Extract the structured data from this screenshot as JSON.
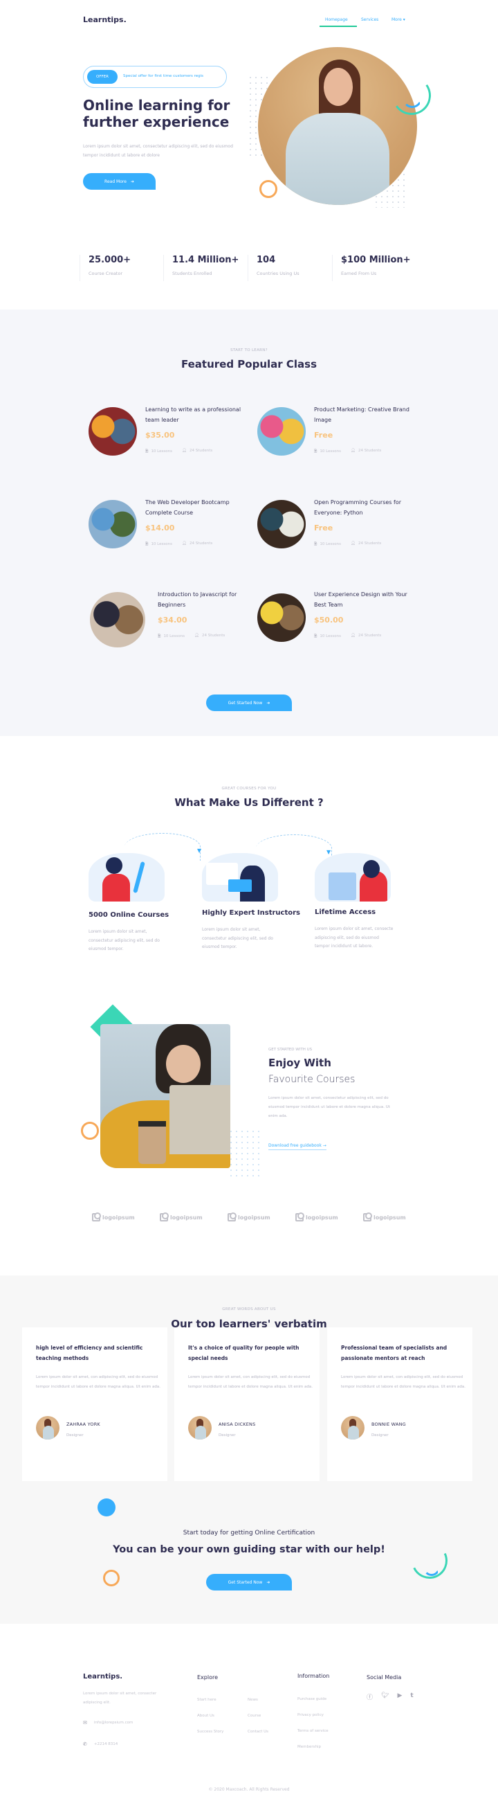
{
  "header": {
    "logo": "Learntips.",
    "nav": [
      {
        "label": "Homepage",
        "active": true
      },
      {
        "label": "Services",
        "active": false
      },
      {
        "label": "More",
        "has_dropdown": true
      }
    ]
  },
  "hero": {
    "offer_badge": "OFFER",
    "offer_text": "Special offer for first time customers regis",
    "title": "Online learning for further experience",
    "description": "Lorem ipsum dolor sit amet, consectetur adipiscing elit, sed do eiusmod tempor incididunt ut labore et dolore",
    "button_label": "Read More",
    "button_icon": "arrow-right-icon"
  },
  "stats": [
    {
      "value": "25.000+",
      "label": "Course Creator"
    },
    {
      "value": "11.4 Million+",
      "label": "Students Enrolled"
    },
    {
      "value": "104",
      "label": "Countries Using Us"
    },
    {
      "value": "$100 Million+",
      "label": "Earned From Us"
    }
  ],
  "featured": {
    "kicker": "START TO LEARN?",
    "title": "Featured Popular Class",
    "courses": [
      {
        "title": "Learning to write as a professional team leader",
        "price": "$35.00",
        "lessons": "10 Lessons",
        "students": "24 Students"
      },
      {
        "title": "Product Marketing: Creative Brand Image",
        "price": "Free",
        "lessons": "10 Lessons",
        "students": "24 Students"
      },
      {
        "title": "The Web Developer Bootcamp Complete Course",
        "price": "$14.00",
        "lessons": "10 Lessons",
        "students": "24 Students"
      },
      {
        "title": "Open Programming Courses for Everyone: Python",
        "price": "Free",
        "lessons": "10 Lessons",
        "students": "24 Students"
      },
      {
        "title": "Introduction to Javascript for Beginners",
        "price": "$34.00",
        "lessons": "10 Lessons",
        "students": "24 Students"
      },
      {
        "title": "User Experience Design with Your Best Team",
        "price": "$50.00",
        "lessons": "10 Lessons",
        "students": "24 Students"
      }
    ],
    "button_label": "Get Started Now"
  },
  "different": {
    "kicker": "GREAT COURSES FOR YOU",
    "title": "What Make Us Different ?",
    "features": [
      {
        "title": "5000 Online Courses",
        "description": "Lorem ipsum dolor sit amet, consectetur adipiscing elit, sed do eiusmod tempor."
      },
      {
        "title": "Highly Expert Instructors",
        "description": "Lorem ipsum dolor sit amet, consectetur adipiscing elit, sed do eiusmod tempor."
      },
      {
        "title": "Lifetime Access",
        "description": "Lorem ipsum dolor sit amet, consecte adipiscing elit, sed do eiusmod tempor incididunt ut labore."
      }
    ]
  },
  "enjoy": {
    "kicker": "GET STARTED WITH US",
    "title_bold": "Enjoy With",
    "title_light": "Favourite Courses",
    "description": "Lorem ipsum dolor sit amet, consectetur adipiscing elit, sed do eiusmod tempor incididunt ut labore et dolore magna aliqua. Ut enim ada.",
    "link_label": "Download free guidebook",
    "link_icon": "→"
  },
  "partner_logos": [
    "logoipsum",
    "logoipsum",
    "logoipsum",
    "logoipsum",
    "logoipsum"
  ],
  "testimonials": {
    "kicker": "GREAT WORDS ABOUT US",
    "title": "Our top learners' verbatim",
    "items": [
      {
        "title": "high level of efficiency and scientific teaching methods",
        "body": "Lorem ipsum dolor sit amet, con adipiscing elit, sed do eiusmod tempor incididunt ut labore et dolore magna aliqua. Ut enim ada.",
        "name": "ZAHRAA YORK",
        "role": "Designer"
      },
      {
        "title": "It's a choice of quality for people with special needs",
        "body": "Lorem ipsum dolor sit amet, con adipiscing elit, sed do eiusmod tempor incididunt ut labore et dolore magna aliqua. Ut enim ada.",
        "name": "ANISA DICKENS",
        "role": "Designer"
      },
      {
        "title": "Professional team of specialists and passionate mentors at reach",
        "body": "Lorem ipsum dolor sit amet, con adipiscing elit, sed do eiusmod tempor incididunt ut labore et dolore magna aliqua. Ut enim ada.",
        "name": "BONNIE WANG",
        "role": "Designer"
      }
    ]
  },
  "cta": {
    "subtitle": "Start today for getting Online Certification",
    "title": "You can be your own guiding star with our help!",
    "button_label": "Get Started Now"
  },
  "footer": {
    "logo": "Learntips.",
    "description": "Lorem ipsum dolor sit amet, consecter adipiscing elit.",
    "email": "info@lorepsium.com",
    "phone": "+2214 8314",
    "explore": {
      "heading": "Explore",
      "col1": [
        "Start here",
        "About Us",
        "Success Story"
      ],
      "col2": [
        "News",
        "Course",
        "Contact Us"
      ]
    },
    "information": {
      "heading": "Information",
      "links": [
        "Purchase guide",
        "Privacy policy",
        "Terms of service",
        "Membership"
      ]
    },
    "social": {
      "heading": "Social Media",
      "icons": [
        "facebook-icon",
        "twitter-icon",
        "youtube-icon",
        "tumblr-icon"
      ]
    },
    "copyright": "© 2020 Maxcoach. All Rights Reserved"
  },
  "colors": {
    "accent_blue": "#36aefc",
    "accent_green": "#3bd6b6",
    "accent_orange": "#f7a858",
    "price": "#f8c37e",
    "heading": "#2f2d51",
    "muted": "#b5b5c3"
  }
}
